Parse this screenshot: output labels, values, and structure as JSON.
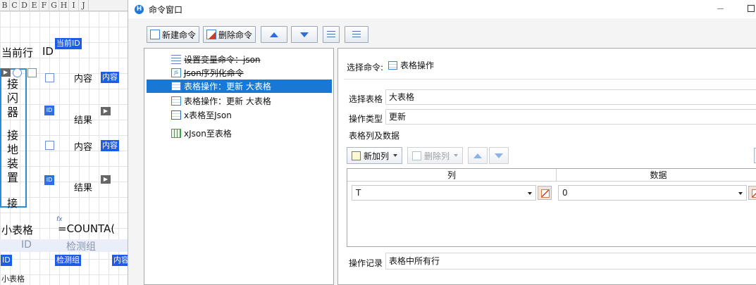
{
  "sheet": {
    "columns": [
      "B",
      "C",
      "D",
      "E",
      "F",
      "G",
      "H",
      "I",
      "J"
    ],
    "current_row_label": "当前行",
    "id_label": "ID",
    "current_id_tag": "当前ID",
    "group1": {
      "chars": [
        "接",
        "闪",
        "器"
      ],
      "content_label": "内容",
      "content_tag": "内容",
      "result_label": "结果",
      "id_icon": "ID"
    },
    "group2": {
      "chars": [
        "接",
        "地",
        "装",
        "置"
      ],
      "content_label": "内容",
      "content_tag": "内容",
      "result_label": "结果",
      "id_icon": "ID"
    },
    "next_char": "接",
    "small_table_label": "小表格",
    "formula": "=COUNTA(",
    "fx": "fx",
    "header_id": "ID",
    "header_group": "检测组",
    "tag_id": "ID",
    "tag_group": "检测组",
    "tag_content": "内容",
    "bottom_label": "小表格"
  },
  "window": {
    "title": "命令窗口",
    "app_icon_letter": "H"
  },
  "toolbar": {
    "new_command": "新建命令",
    "delete_command": "删除命令"
  },
  "commands": [
    {
      "label": "设置变量命令：json",
      "icon": "settings-icon",
      "struck": true
    },
    {
      "label": "Json序列化命令",
      "icon": "json-icon",
      "struck": true
    },
    {
      "label": "表格操作：更新 大表格",
      "icon": "table-icon",
      "selected": true
    },
    {
      "label": "表格操作：更新 大表格",
      "icon": "table-icon"
    },
    {
      "label": "x表格至Json",
      "icon": "table-green-icon"
    },
    {
      "label": "xJson至表格",
      "icon": "table-green-icon"
    }
  ],
  "props": {
    "select_command_label": "选择命令:",
    "select_command_value": "表格操作",
    "select_table_label": "选择表格",
    "select_table_value": "大表格",
    "op_type_label": "操作类型",
    "op_type_value": "更新",
    "columns_data_label": "表格列及数据",
    "add_column": "新加列",
    "delete_column": "删除列",
    "col_header": "列",
    "data_header": "数据",
    "row_col_value": "T",
    "row_data_value": "0",
    "op_record_label": "操作记录",
    "op_record_value": "表格中所有行"
  }
}
